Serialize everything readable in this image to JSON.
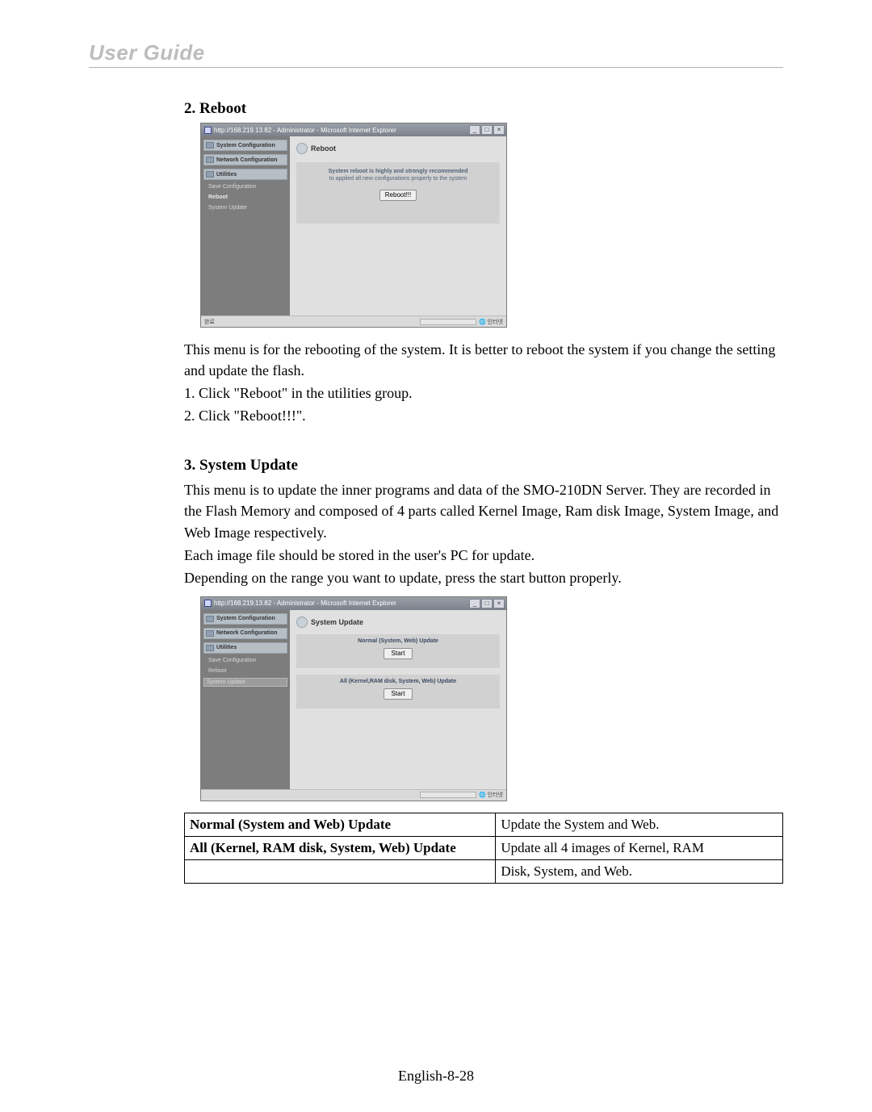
{
  "header": {
    "title": "User Guide"
  },
  "section_reboot": {
    "heading": "2. Reboot",
    "desc": "This menu is for the rebooting of the system. It is better to reboot the system if you change the setting and update the flash.",
    "step1": "1. Click \"Reboot\" in the utilities group.",
    "step2": "2. Click \"Reboot!!!\".",
    "screenshot": {
      "window_title": "http://168.219.13.82 - Administrator - Microsoft Internet Explorer",
      "sidebar": {
        "sys_conf": "System Configuration",
        "net_conf": "Network Configuration",
        "utilities": "Utilities",
        "save_conf": "Save Configuration",
        "reboot": "Reboot",
        "sys_update": "System Update"
      },
      "main_title": "Reboot",
      "line1": "System reboot is highly and strongly recommended",
      "line2": "to applied all new configurations properly to the system",
      "button": "Reboot!!!",
      "status_left": "완료",
      "status_right": "인터넷"
    }
  },
  "section_update": {
    "heading": "3. System Update",
    "p1": "This menu is to update the inner programs and data of the SMO-210DN Server. They are recorded in the Flash Memory and composed of 4 parts called Kernel Image, Ram disk Image, System Image, and Web Image respectively.",
    "p2": "Each image file should be stored in the user's PC for update.",
    "p3": "Depending on the range you want to update, press the start button properly.",
    "screenshot": {
      "window_title": "http://168.219.13.82 - Administrator - Microsoft Internet Explorer",
      "sidebar": {
        "sys_conf": "System Configuration",
        "net_conf": "Network Configuration",
        "utilities": "Utilities",
        "save_conf": "Save Configuration",
        "reboot": "Reboot",
        "sys_update": "System Update"
      },
      "main_title": "System Update",
      "row1_label": "Normal (System, Web) Update",
      "row1_button": "Start",
      "row2_label": "All (Kernel,RAM disk, System, Web) Update",
      "row2_button": "Start",
      "status_right": "인터넷"
    },
    "table": {
      "r1c1": "Normal (System and Web) Update",
      "r1c2": "Update the System and Web.",
      "r2c1": "All (Kernel, RAM disk, System, Web) Update",
      "r2c2a": "Update all 4 images of Kernel, RAM",
      "r2c2b": "Disk, System, and Web."
    }
  },
  "footer": "English-8-28"
}
